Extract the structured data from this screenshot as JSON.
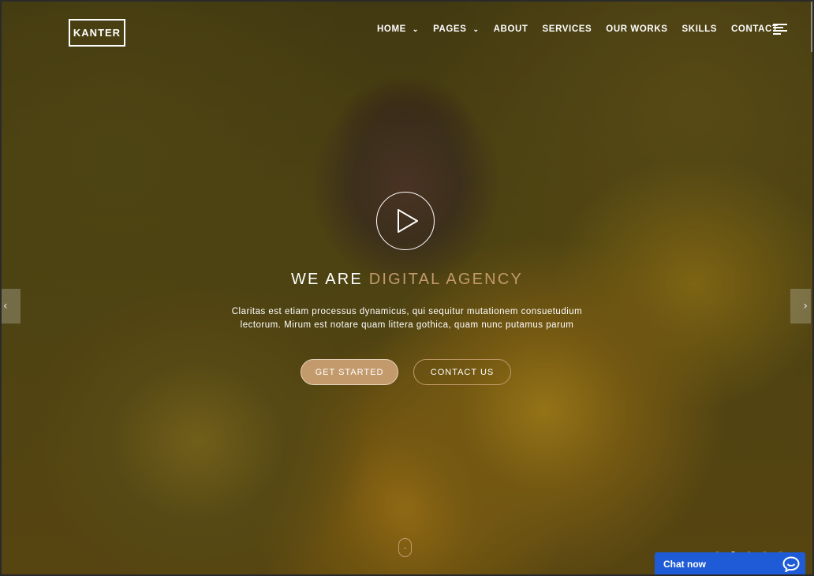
{
  "header": {
    "logo": "KANTER",
    "nav": [
      {
        "label": "HOME",
        "dropdown": true
      },
      {
        "label": "PAGES",
        "dropdown": true
      },
      {
        "label": "ABOUT",
        "dropdown": false
      },
      {
        "label": "SERVICES",
        "dropdown": false
      },
      {
        "label": "OUR WORKS",
        "dropdown": false
      },
      {
        "label": "SKILLS",
        "dropdown": false
      },
      {
        "label": "CONTACT",
        "dropdown": false
      }
    ],
    "chevron_glyph": "⌄",
    "menu_icon": "hamburger-menu-icon"
  },
  "hero": {
    "headline_prefix": "WE ARE ",
    "headline_accent": "DIGITAL AGENCY",
    "description_line1": "Claritas est etiam processus dynamicus, qui sequitur mutationem consuetudium",
    "description_line2": "lectorum. Mirum est notare quam littera gothica, quam nunc putamus parum",
    "primary_button": "GET STARTED",
    "secondary_button": "CONTACT US",
    "play_icon": "play-icon",
    "scroll_down_glyph": "⌄"
  },
  "slider": {
    "prev_glyph": "‹",
    "next_glyph": "›",
    "dot_count": 5,
    "active_dot": 2
  },
  "chat": {
    "label": "Chat now",
    "icon": "chat-bubble-icon"
  },
  "colors": {
    "accent": "#c39a6b",
    "chat_blue": "#1f5bd6",
    "text": "#ffffff"
  }
}
